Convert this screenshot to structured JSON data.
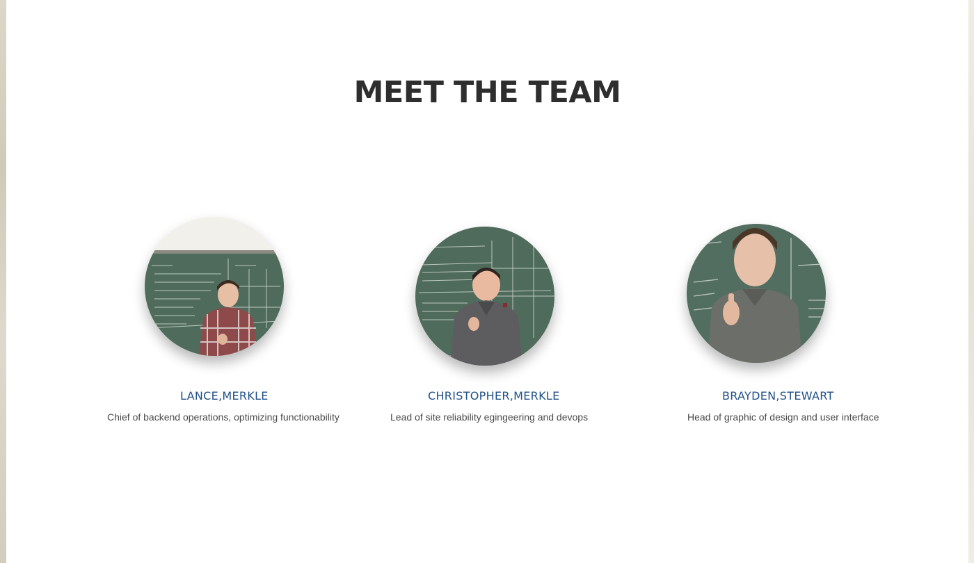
{
  "section": {
    "title": "MEET THE TEAM"
  },
  "team": [
    {
      "name": "LANCE,MERKLE",
      "role": "Chief of backend operations, optimizing functionability",
      "photo_icon": "team-member-photo"
    },
    {
      "name": "CHRISTOPHER,MERKLE",
      "role": "Lead of site reliability egingeering and devops",
      "photo_icon": "team-member-photo"
    },
    {
      "name": "BRAYDEN,STEWART",
      "role": "Head of graphic of design and user interface",
      "photo_icon": "team-member-photo"
    }
  ],
  "colors": {
    "title": "#2e2e2e",
    "name": "#1f4f87",
    "role": "#4a4a4a",
    "chalkboard": "#4f6b5c"
  }
}
